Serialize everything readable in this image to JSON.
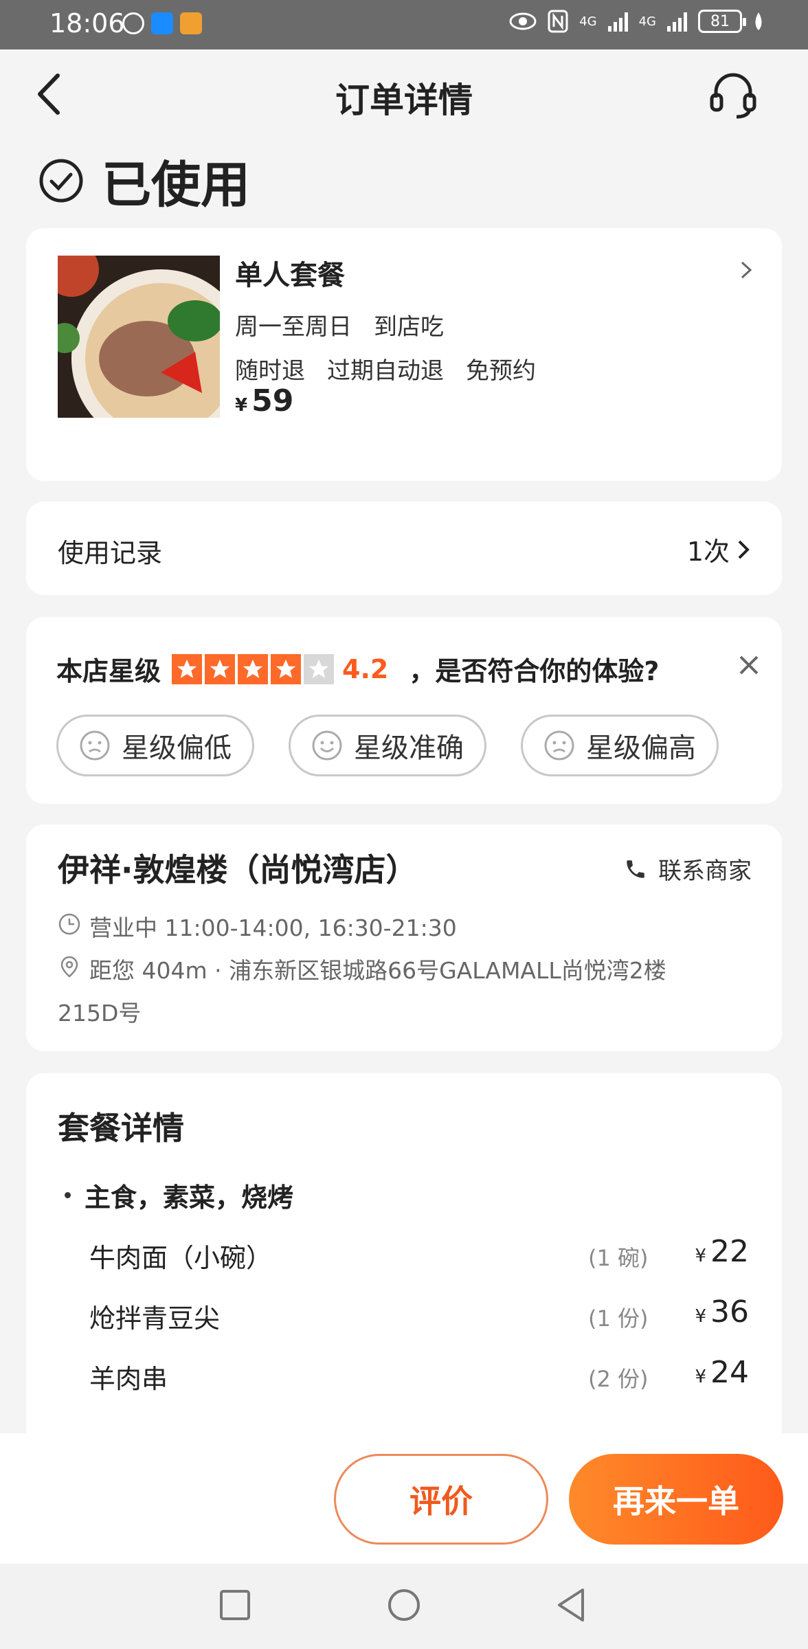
{
  "status_bar": {
    "time": "18:06",
    "battery": "81",
    "network_a": "4G",
    "network_b": "4G"
  },
  "header": {
    "title": "订单详情"
  },
  "order_status": "已使用",
  "product": {
    "title": "单人套餐",
    "tags_line1": [
      "周一至周日",
      "到店吃"
    ],
    "tags_line2": [
      "随时退",
      "过期自动退",
      "免预约"
    ],
    "currency": "¥",
    "price": "59"
  },
  "usage": {
    "label": "使用记录",
    "count": "1次"
  },
  "rating": {
    "label": "本店星级",
    "score": "4.2",
    "stars": 4,
    "question": "，是否符合你的体验?",
    "chips": [
      "星级偏低",
      "星级准确",
      "星级偏高"
    ]
  },
  "store": {
    "name": "伊祥·敦煌楼（尚悦湾店）",
    "contact": "联系商家",
    "hours": "营业中 11:00-14:00, 16:30-21:30",
    "address_line1": "距您 404m · 浦东新区银城路66号GALAMALL尚悦湾2楼",
    "address_line2": "215D号"
  },
  "package": {
    "title": "套餐详情",
    "category": "主食，素菜，烧烤",
    "items": [
      {
        "name": "牛肉面（小碗）",
        "qty": "(1 碗)",
        "currency": "¥",
        "price": "22"
      },
      {
        "name": "炝拌青豆尖",
        "qty": "(1 份)",
        "currency": "¥",
        "price": "36"
      },
      {
        "name": "羊肉串",
        "qty": "(2 份)",
        "currency": "¥",
        "price": "24"
      }
    ]
  },
  "actions": {
    "review": "评价",
    "reorder": "再来一单"
  },
  "colors": {
    "accent": "#ff5a1f",
    "star": "#ff6a2a"
  }
}
